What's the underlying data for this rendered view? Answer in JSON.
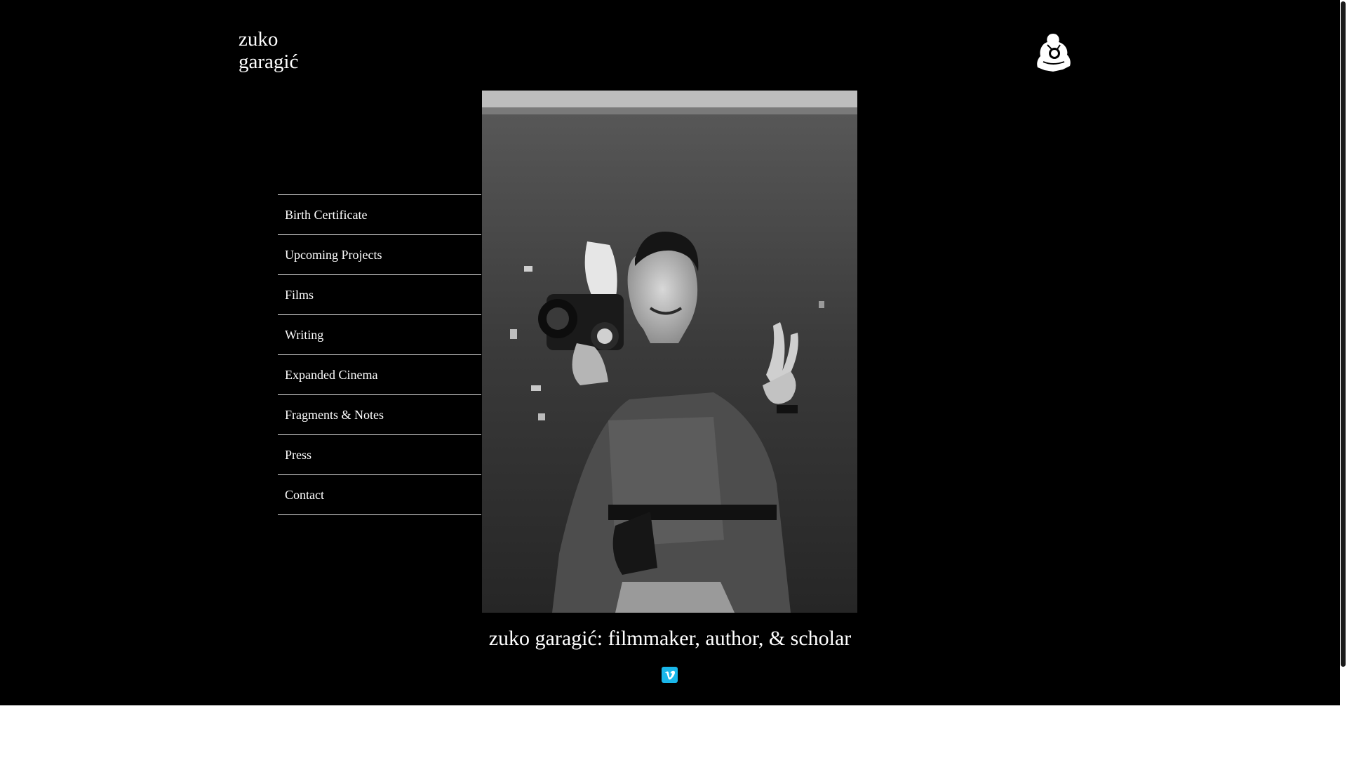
{
  "site": {
    "logo_line1": "zuko",
    "logo_line2": "garagić",
    "tagline": "zuko garagić: filmmaker, author, & scholar"
  },
  "nav": {
    "items": [
      {
        "label": "Birth Certificate"
      },
      {
        "label": "Upcoming Projects"
      },
      {
        "label": "Films"
      },
      {
        "label": "Writing"
      },
      {
        "label": "Expanded Cinema"
      },
      {
        "label": "Fragments & Notes"
      },
      {
        "label": "Press"
      },
      {
        "label": "Contact"
      }
    ]
  },
  "icons": {
    "header_right": "mascot-icon",
    "social": "vimeo-icon"
  },
  "colors": {
    "background": "#000000",
    "text": "#ffffff",
    "nav_divider": "#e6e6e6",
    "vimeo": "#1ab7ea"
  }
}
